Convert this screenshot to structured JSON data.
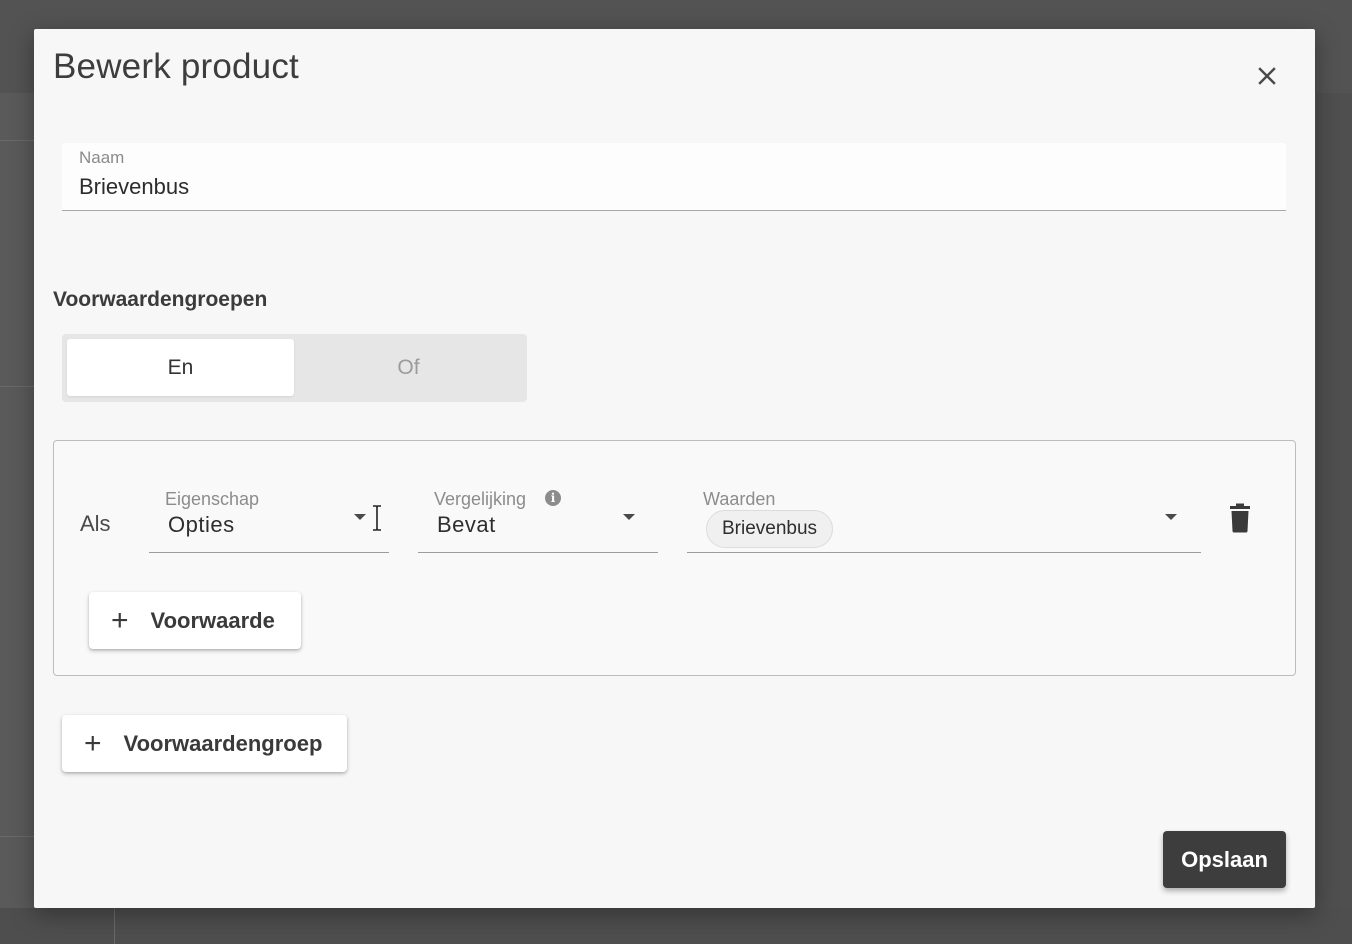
{
  "dialog": {
    "title": "Bewerk product"
  },
  "name_field": {
    "label": "Naam",
    "value": "Brievenbus"
  },
  "conditions": {
    "heading": "Voorwaardengroepen",
    "toggle": {
      "options": [
        "En",
        "Of"
      ],
      "selected": "En"
    },
    "group": {
      "prefix": "Als",
      "property": {
        "label": "Eigenschap",
        "value": "Opties"
      },
      "comparison": {
        "label": "Vergelijking",
        "value": "Bevat",
        "info_icon": "info-icon"
      },
      "values": {
        "label": "Waarden",
        "chips": [
          "Brievenbus"
        ]
      },
      "add_condition_label": "Voorwaarde"
    },
    "add_group_label": "Voorwaardengroep"
  },
  "actions": {
    "save_label": "Opslaan"
  },
  "icons": {
    "close": "close-icon",
    "delete": "trash-icon",
    "add": "plus-icon",
    "dropdown": "caret-down-icon"
  },
  "colors": {
    "primary_button": "#3d3d3d",
    "dialog_background": "#f7f7f7",
    "overlay": "#5a5a5a"
  }
}
